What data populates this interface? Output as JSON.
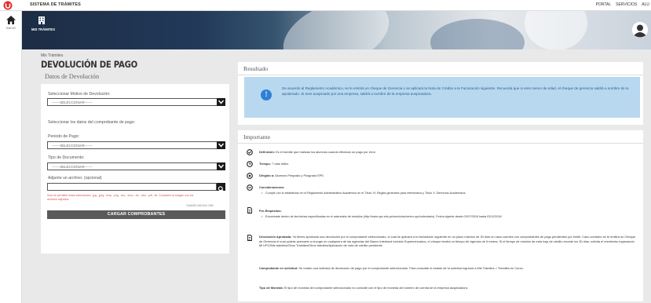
{
  "header": {
    "system_title": "SISTEMA DE TRÁMITES",
    "nav_items": [
      "PORTAL",
      "SERVICIOS",
      "ALU"
    ]
  },
  "left_nav": {
    "home_label": "INICIO"
  },
  "banner": {
    "mis_tramites_label": "MIS TRÁMITES"
  },
  "breadcrumb": "Mis Trámites",
  "page_title": "DEVOLUCIÓN DE PAGO",
  "subtitle": "Datos de Devolución",
  "form": {
    "motivo_label": "Seleccionar Motivo de Devolución:",
    "motivo_value": "-------SELECCIONAR-------",
    "comprobante_label": "Seleccionar los datos del comprobante de pago:",
    "periodo_label": "Periodo de Pago:",
    "periodo_value": "-------SELECCIONAR-------",
    "tipo_label": "Tipo de Documento:",
    "tipo_value": "-------SELECCIONAR-------",
    "archivo_label": "Adjunte un archivo: (opcional)",
    "archivo_value": "",
    "error_text": "Solo se permiten estas extensiones: .jpg, .jpeg, .bmp, .png, .doc, .docx, .xls, .xlsx, .pdf, .txt. Considere la imagen con los archivos adjuntos.",
    "small_link": "TAMAÑO MÁXIMO 2MB",
    "load_button": "CARGAR COMPROBANTES"
  },
  "resultado": {
    "title": "Resultado",
    "message": "De acuerdo al Reglamento Académico, se le emitirá un cheque de Gerencia o se aplicará la Nota de Crédito a la Facturación siguiente. Recuerda que si eres menor de edad, el cheque de gerencia saldrá a nombre de tu apoderado. Si eres auspiciado por una empresa, saldrá a nombre de la empresa auspiciadora."
  },
  "importante": {
    "title": "Importante",
    "items": [
      {
        "icon": "check-circle-icon",
        "label": "Definición:",
        "text": "Es el trámite que realizan los alumnos cuando efectúan un pago por error."
      },
      {
        "icon": "clock-icon",
        "label": "Tiempo:",
        "text": "7 días útiles."
      },
      {
        "icon": "target-icon",
        "label": "Dirigido a:",
        "text": "Alumnos Pregrado y Posgrado EPE."
      },
      {
        "icon": "minus-circle-icon",
        "label": "Consideraciones:",
        "text": "",
        "bullets": [
          "Cumplir con lo establecido en el Reglamento Administrativo Académico en el Título VI: Reglas generales para reembolsos y Título X: Derechos Académicos."
        ]
      },
      {
        "icon": "document-icon",
        "label": "Pre-Requisitos:",
        "text": "",
        "bullets": [
          "Encontrarte dentro de las fechas especificadas en el calendario de estudios (http://www.upc.edu.pe/servicios/centro-upc/calendario). Fecha vigente desde 02/07/2018 hasta 03/12/2018."
        ]
      },
      {
        "icon": "document-icon",
        "label": "Devolución Aprobada:",
        "text": "Ya tienes aprobada una devolución por el comprobante seleccionado, el cual se aplicará a tu facturación siguiente en un plazo máximo de 30 días en caso cuentes con comprobantes de pago pendientes por emitir. Caso contrario se te emitirá un Cheque de Gerencia el cual podrás acercarte a recoger en cualquiera de las agencias del Banco Interbank incluido Supermercados, el cheque tendrá un tiempo de vigencia de 6 meses. Si el tiempo de emisión de esta hoja de crédito excede los 30 días, solicita el reembolso ingresando Mi UPC/Mis trámites/Otros Trámites/Otros trámites/Aplicación de nota de crédito pendiente."
      },
      {
        "icon": "",
        "label": "Comprobante en solicitud:",
        "text": "Se realizó una solicitud de devolución de pago por el comprobante seleccionado. Para consultar el estado de tu solicitud ingresar a Mis Trámites > Trámites en Curso."
      },
      {
        "icon": "",
        "label": "Tipo de Moneda:",
        "text": "El tipo de moneda del comprobante seleccionado no coincide con el tipo de moneda del número de cuenta de la empresa auspiciadora."
      }
    ]
  },
  "colors": {
    "brand_red": "#e32d2d",
    "alert_bg": "#b8d8f0",
    "alert_icon": "#2e7fd6",
    "dark_button": "#5a5a5a"
  }
}
